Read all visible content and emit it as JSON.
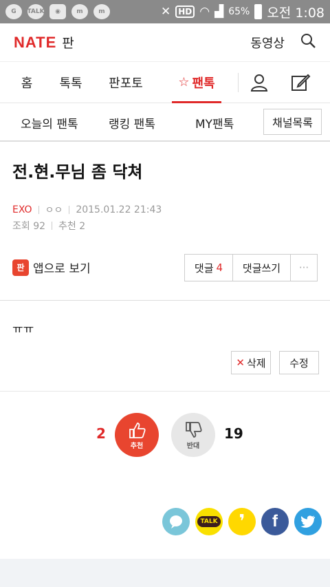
{
  "status_bar": {
    "notification_icons": [
      "G",
      "TALK",
      "◉",
      "m",
      "m"
    ],
    "hd": "HD",
    "battery": "65%",
    "time": "오전 1:08"
  },
  "header": {
    "logo": "NATE",
    "section": "판",
    "video_link": "동영상"
  },
  "main_nav": {
    "tabs": [
      "홈",
      "톡톡",
      "판포토",
      "팬톡"
    ],
    "active_tab": "팬톡"
  },
  "sub_nav": {
    "items": [
      "오늘의 팬톡",
      "랭킹 팬톡",
      "MY팬톡"
    ],
    "channel_list": "채널목록"
  },
  "post": {
    "title": "전.현.무님 좀 닥쳐",
    "category": "EXO",
    "author": "ㅇㅇ",
    "datetime": "2015.01.22 21:43",
    "views_label": "조회 92",
    "recommend_label": "추천 2",
    "body": "ㅠㅠ"
  },
  "actions": {
    "app_view": "앱으로 보기",
    "app_icon_glyph": "판",
    "comments_label": "댓글",
    "comments_count": "4",
    "write_comment": "댓글쓰기",
    "more": "···",
    "delete": "삭제",
    "edit": "수정"
  },
  "vote": {
    "up_count": "2",
    "up_label": "추천",
    "down_label": "반대",
    "down_count": "19"
  },
  "share": {
    "talk_label": "TALK",
    "story_glyph": "❜",
    "facebook_glyph": "f",
    "colors": {
      "band": "#7ac6d9",
      "kakaotalk": "#f9e000",
      "kakaostory": "#ffd800",
      "facebook": "#3b5a9a",
      "twitter": "#30a0e0"
    }
  },
  "colors": {
    "accent": "#e02a2a",
    "vote_up": "#e8452f"
  }
}
